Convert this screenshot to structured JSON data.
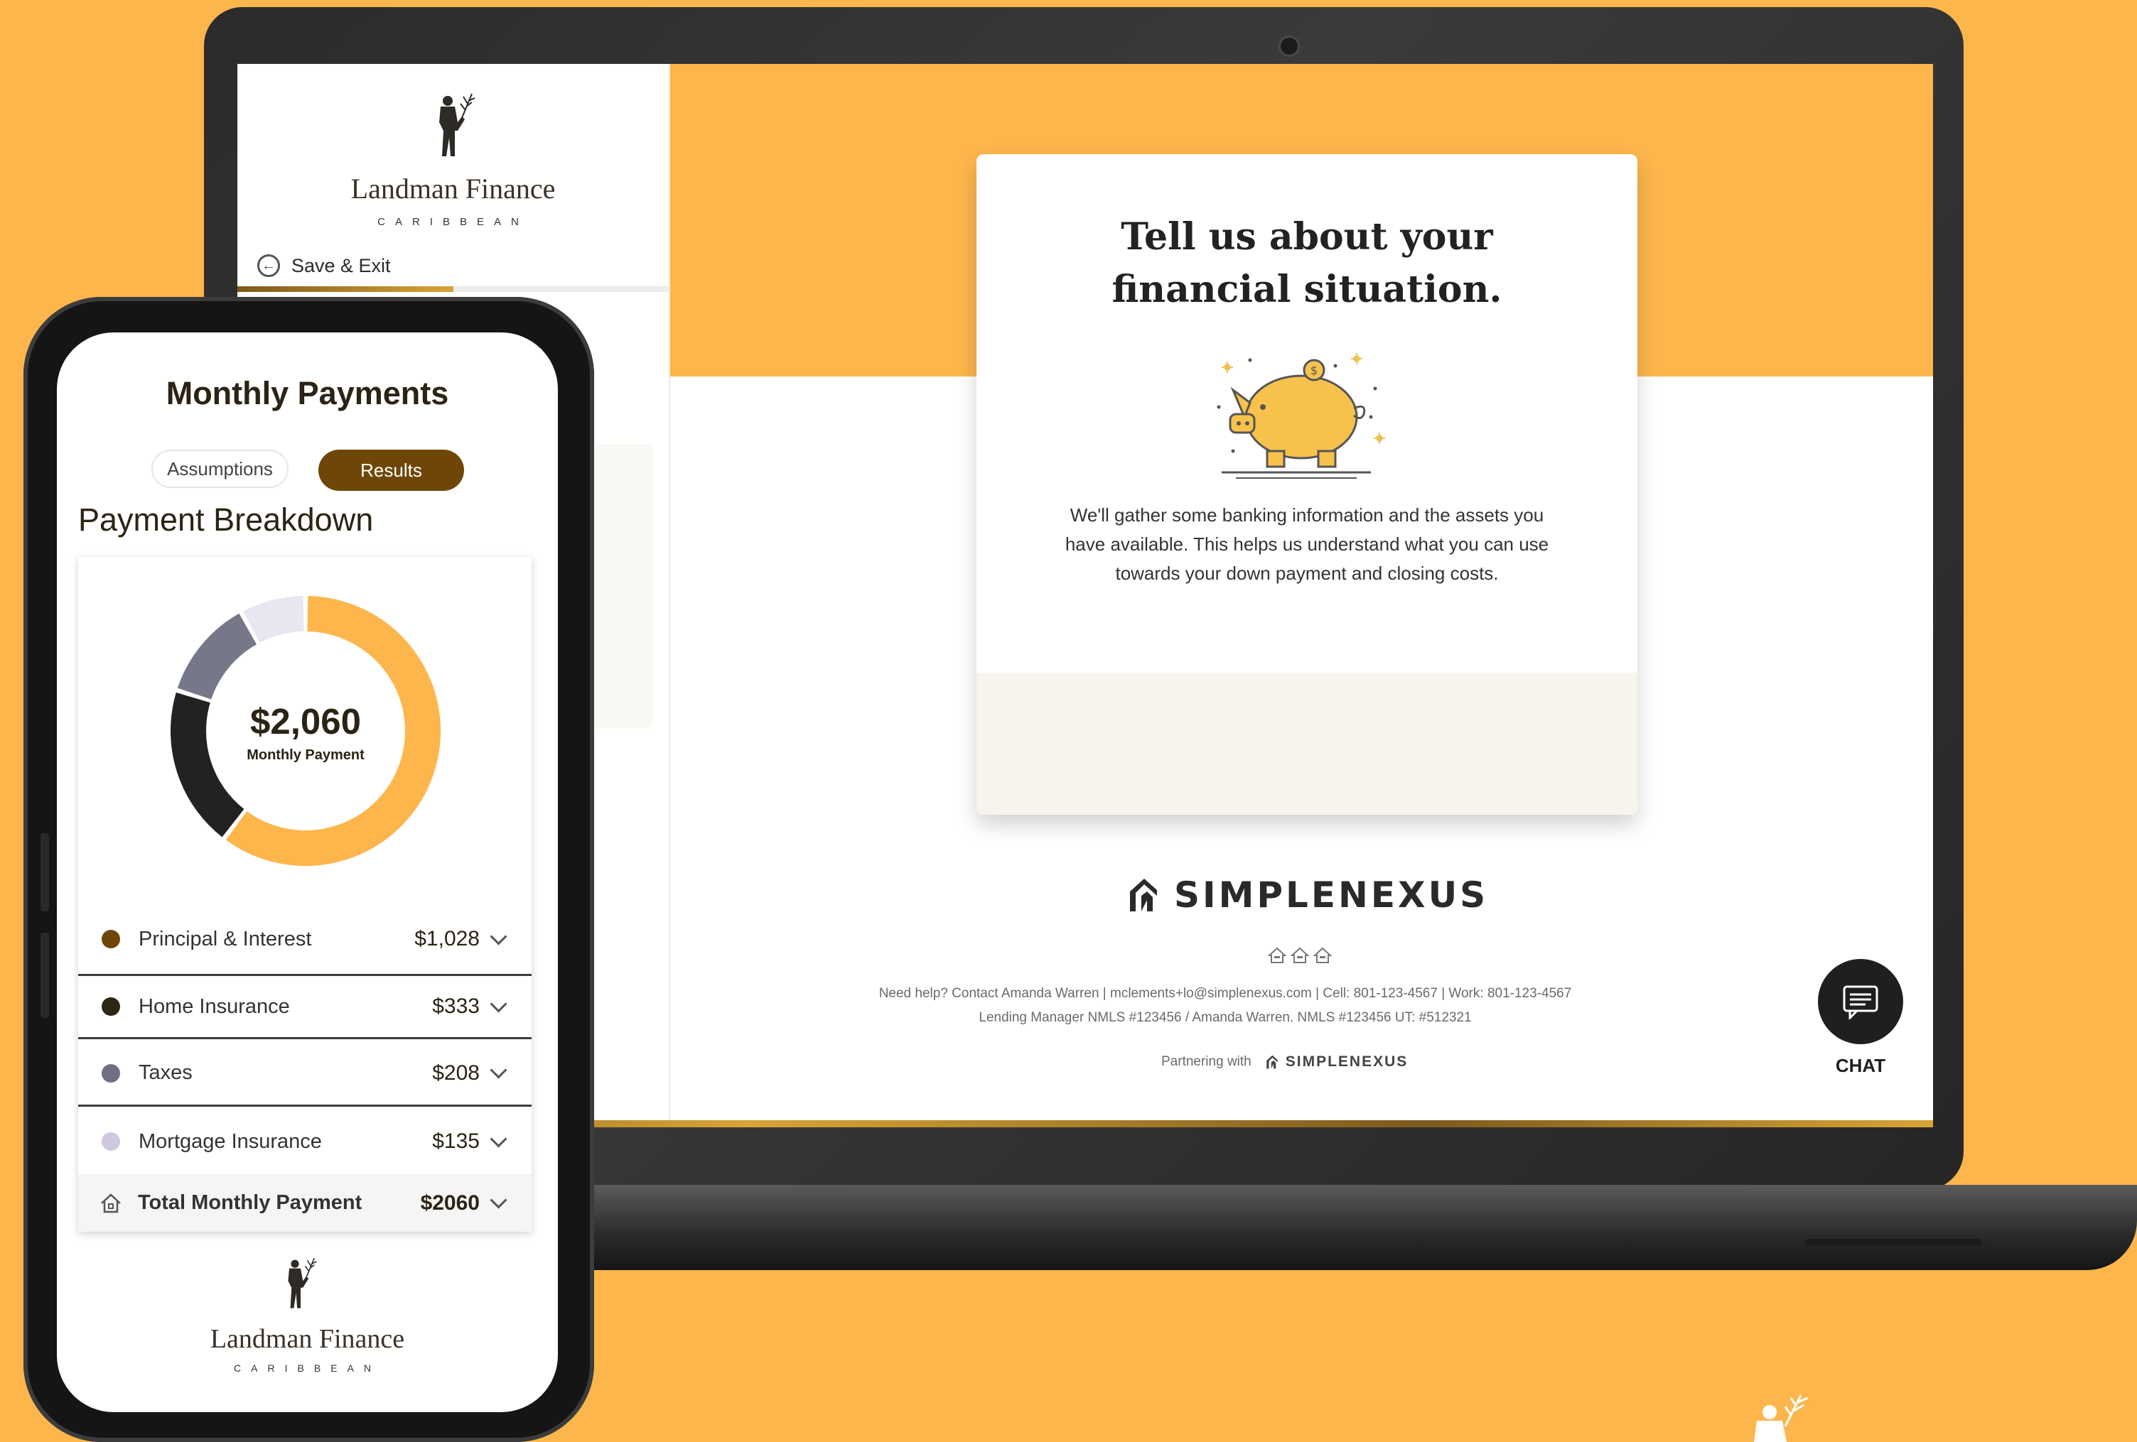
{
  "brand": {
    "name": "Landman Finance",
    "tagline": "CARIBBEAN"
  },
  "desktop": {
    "sidebar": {
      "save_exit_label": "Save & Exit",
      "progress": 0.5
    },
    "card": {
      "title_line1": "Tell us about your",
      "title_line2": "financial situation.",
      "body_line1": "We'll gather some banking information and the assets you",
      "body_line2": "have available. This helps us understand what you can use",
      "body_line3": "towards your down payment and closing costs."
    },
    "footer": {
      "logo_word": "SIMPLENEXUS",
      "help_line": "Need help? Contact Amanda Warren  |  mclements+lo@simplenexus.com  |  Cell: 801-123-4567  |  Work: 801-123-4567",
      "nmls_line": "Lending Manager NMLS #123456 / Amanda Warren. NMLS #123456 UT: #512321",
      "partnering_label": "Partnering with",
      "partner_brand": "SIMPLENEXUS"
    },
    "chat": {
      "label": "CHAT",
      "icon": "chat-icon"
    }
  },
  "mobile": {
    "title": "Monthly Payments",
    "tabs": [
      {
        "label": "Assumptions",
        "active": false
      },
      {
        "label": "Results",
        "active": true
      }
    ],
    "section_heading": "Payment Breakdown",
    "donut": {
      "value": "$2,060",
      "label": "Monthly Payment"
    },
    "rows": [
      {
        "label": "Principal & Interest",
        "amount": "$1,028",
        "value": 1028,
        "color": "#6E4708"
      },
      {
        "label": "Home Insurance",
        "amount": "$333",
        "value": 333,
        "color": "#2E2614"
      },
      {
        "label": "Taxes",
        "amount": "$208",
        "value": 208,
        "color": "#6E6F82"
      },
      {
        "label": "Mortgage Insurance",
        "amount": "$135",
        "value": 135,
        "color": "#CFC8E0"
      }
    ],
    "donut_colors": [
      "#FDB64C",
      "#222222",
      "#767789",
      "#E8E6F0"
    ],
    "total": {
      "label": "Total Monthly Payment",
      "amount": "$2060",
      "icon": "home-icon"
    }
  },
  "colors": {
    "background": "#FDB64C",
    "accent_brown": "#6E4708"
  }
}
